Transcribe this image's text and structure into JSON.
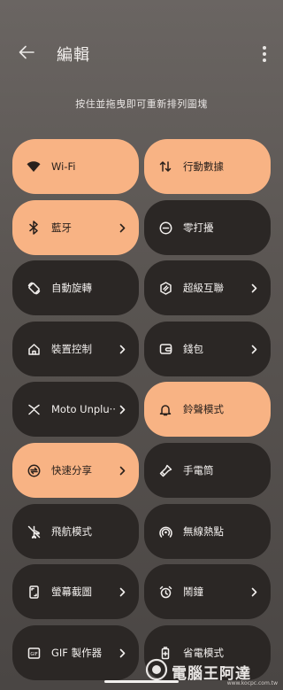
{
  "header": {
    "title": "編輯",
    "back_icon": "arrow-left-icon",
    "more_icon": "more-vertical-icon"
  },
  "hint": "按住並拖曳即可重新排列圖塊",
  "colors": {
    "tile_on": "#f8b384",
    "tile_off": "#2b2725",
    "background": "#5a5552"
  },
  "tiles": [
    {
      "label": "Wi-Fi",
      "icon": "wifi-icon",
      "active": true,
      "chevron": false
    },
    {
      "label": "行動數據",
      "icon": "mobile-data-icon",
      "active": true,
      "chevron": false
    },
    {
      "label": "藍牙",
      "icon": "bluetooth-icon",
      "active": true,
      "chevron": true
    },
    {
      "label": "零打擾",
      "icon": "do-not-disturb-icon",
      "active": false,
      "chevron": false
    },
    {
      "label": "自動旋轉",
      "icon": "auto-rotate-icon",
      "active": false,
      "chevron": false
    },
    {
      "label": "超級互聯",
      "icon": "super-connect-icon",
      "active": false,
      "chevron": true
    },
    {
      "label": "裝置控制",
      "icon": "home-icon",
      "active": false,
      "chevron": true
    },
    {
      "label": "錢包",
      "icon": "wallet-icon",
      "active": false,
      "chevron": true
    },
    {
      "label": "Moto Unplu··",
      "icon": "moto-unplugged-icon",
      "active": false,
      "chevron": true
    },
    {
      "label": "鈴聲模式",
      "icon": "bell-icon",
      "active": true,
      "chevron": false
    },
    {
      "label": "快速分享",
      "icon": "quick-share-icon",
      "active": true,
      "chevron": true
    },
    {
      "label": "手電筒",
      "icon": "flashlight-icon",
      "active": false,
      "chevron": false
    },
    {
      "label": "飛航模式",
      "icon": "airplane-off-icon",
      "active": false,
      "chevron": false
    },
    {
      "label": "無線熱點",
      "icon": "hotspot-icon",
      "active": false,
      "chevron": false
    },
    {
      "label": "螢幕截圖",
      "icon": "screenshot-icon",
      "active": false,
      "chevron": true
    },
    {
      "label": "鬧鐘",
      "icon": "alarm-icon",
      "active": false,
      "chevron": true
    },
    {
      "label": "GIF 製作器",
      "icon": "gif-icon",
      "active": false,
      "chevron": true
    },
    {
      "label": "省電模式",
      "icon": "battery-saver-icon",
      "active": false,
      "chevron": false
    }
  ],
  "watermark": {
    "text": "電腦王阿達",
    "url": "www.kocpc.com.tw"
  }
}
